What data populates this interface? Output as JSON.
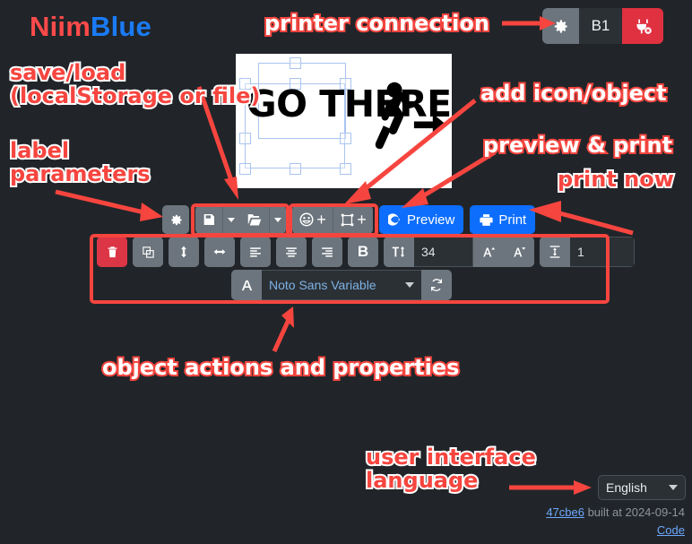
{
  "brand": {
    "part1": "Niim",
    "part2": "Blue",
    "color1": "#fc4a4a",
    "color2": "#1a7bf5"
  },
  "printer_connection": {
    "settings_icon": "gear-icon",
    "model": "B1",
    "disconnect_icon": "plug-disconnect-icon",
    "disconnect_color": "#e03141",
    "settings_bg": "#6c757d"
  },
  "canvas": {
    "label_text": "GO\nTHERE",
    "objects": [
      "text-object-go-there",
      "image-object-exit-sign"
    ],
    "selection_color": "#a9c4ee",
    "background": "#ffffff"
  },
  "toolbar": {
    "settings_label": "gear-icon",
    "save_label": "floppy-disk-icon",
    "save_caret": "caret-down-icon",
    "open_label": "folder-open-icon",
    "open_caret": "caret-down-icon",
    "add_icon_label": "smiley-icon",
    "add_icon_plus": "+",
    "add_object_label": "shape-icon",
    "add_object_plus": "+",
    "preview_label": "Preview",
    "print_label": "Print",
    "button_color": "#0d6efd"
  },
  "object_props": {
    "delete_icon": "trash-icon",
    "duplicate_icon": "copy-icon",
    "flip_vertical_icon": "flip-vertical-icon",
    "flip_horizontal_icon": "flip-horizontal-icon",
    "align_left_icon": "align-left-icon",
    "align_center_icon": "align-center-icon",
    "align_right_icon": "align-right-icon",
    "bold_label": "B",
    "font_size_icon": "font-size-icon",
    "font_size_value": "34",
    "font_size_up_icon": "font-increase-icon",
    "font_size_down_icon": "font-decrease-icon",
    "line_height_icon": "line-height-icon",
    "line_height_value": "1",
    "font_family_icon": "font-letter-icon",
    "font_family_value": "Noto Sans Variable",
    "font_refresh_icon": "refresh-icon",
    "delete_color": "#dc3545"
  },
  "footer": {
    "language_value": "English",
    "language_caret": "caret-down-icon",
    "build_hash": "47cbe6",
    "build_text": " built at 2024-09-14",
    "code_link": "Code"
  },
  "annotations": {
    "printer_connection": "printer connection",
    "save_load": "save/load\n(localStorage or file)",
    "label_parameters": "label\nparameters",
    "add_icon_object": "add icon/object",
    "preview_print": "preview & print",
    "print_now": "print now",
    "object_actions": "object actions and properties",
    "ui_language": "user interface\nlanguage",
    "accent": "#f6453f"
  }
}
